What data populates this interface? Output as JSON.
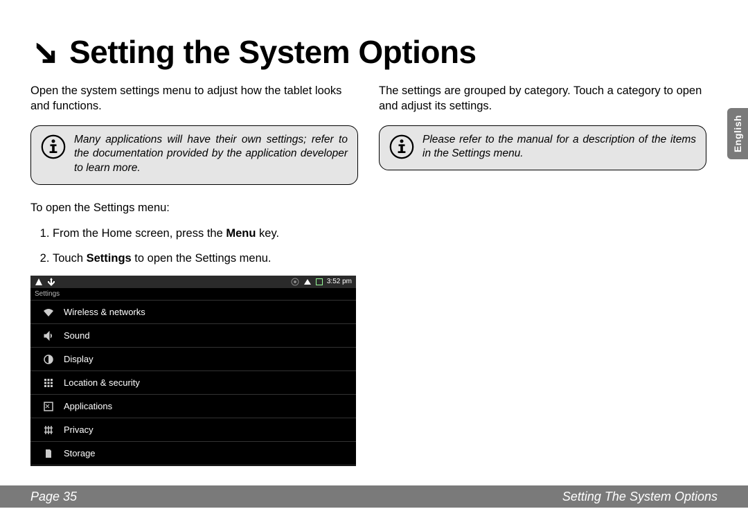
{
  "header": {
    "title": "Setting the System Options"
  },
  "col1": {
    "intro": "Open the system settings menu to adjust how the tablet looks and functions.",
    "note": "Many applications will have their own settings; refer to the documentation provided by the application developer to learn more.",
    "steps_intro": "To open the Settings menu:",
    "step1_pre": "From the Home screen, press the ",
    "step1_bold": "Menu",
    "step1_post": " key.",
    "step2_pre": "Touch ",
    "step2_bold": "Settings",
    "step2_post": " to open the Settings menu."
  },
  "col2": {
    "intro": "The settings are grouped by category. Touch a category to open and adjust its settings.",
    "note": "Please refer to the manual for a description of the items in the Settings menu."
  },
  "tablet": {
    "time": "3:52 pm",
    "header": "Settings",
    "items": [
      {
        "icon": "wifi",
        "label": "Wireless & networks"
      },
      {
        "icon": "sound",
        "label": "Sound"
      },
      {
        "icon": "display",
        "label": "Display"
      },
      {
        "icon": "location",
        "label": "Location & security"
      },
      {
        "icon": "apps",
        "label": "Applications"
      },
      {
        "icon": "privacy",
        "label": "Privacy"
      },
      {
        "icon": "storage",
        "label": "Storage"
      }
    ]
  },
  "lang_tab": "English",
  "footer": {
    "left": "Page 35",
    "right": "Setting The System Options"
  }
}
